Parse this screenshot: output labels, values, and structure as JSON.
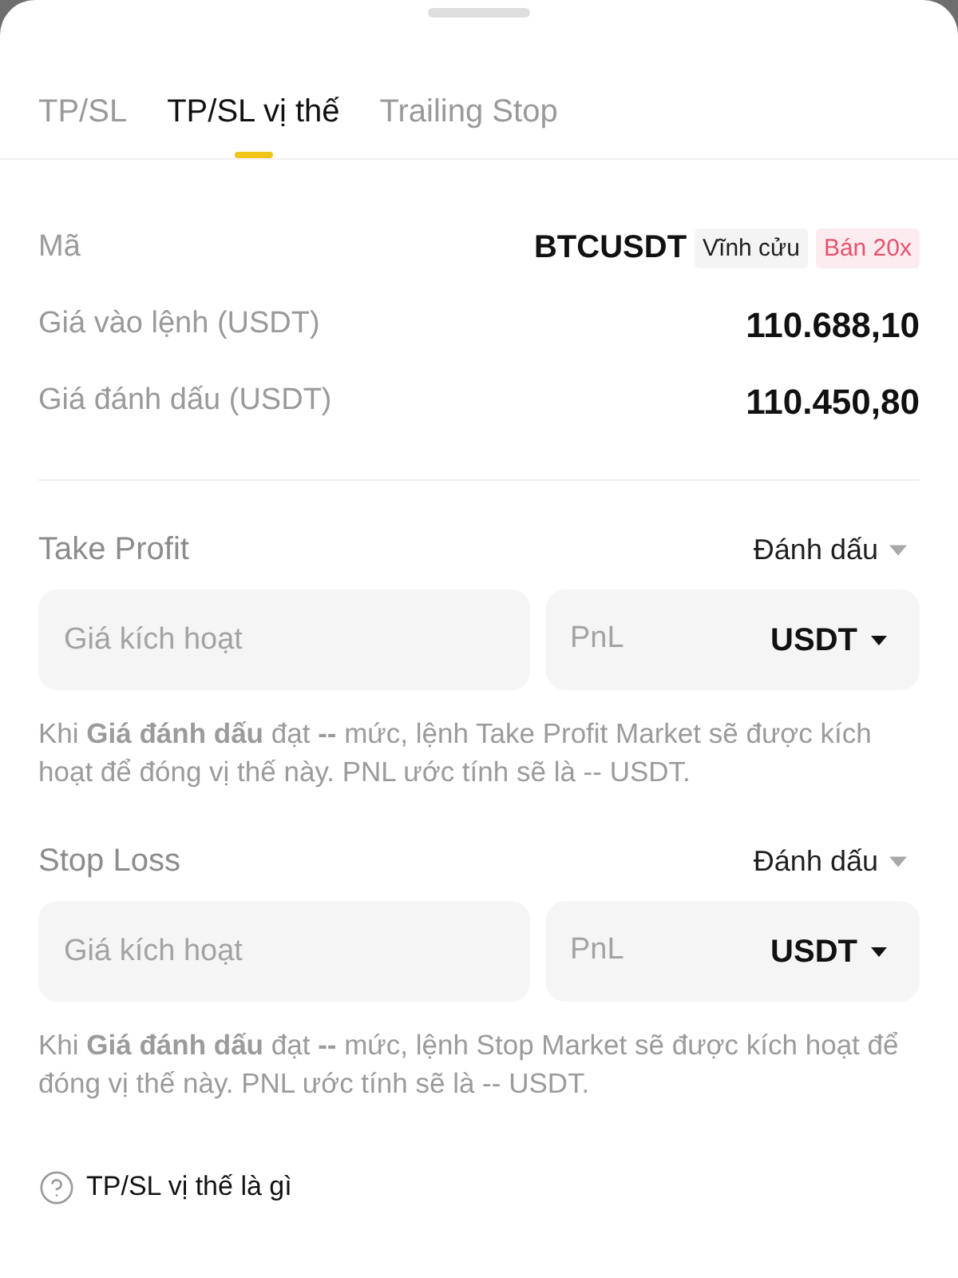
{
  "tabs": [
    {
      "label": "TP/SL",
      "selected": false
    },
    {
      "label": "TP/SL vị thế",
      "selected": true
    },
    {
      "label": "Trailing Stop",
      "selected": false
    }
  ],
  "position": {
    "rows": [
      {
        "kind": "symbol",
        "label": "Mã",
        "value": "BTCUSDT",
        "tags": [
          {
            "kind": "neutral",
            "text": "Vĩnh cửu"
          },
          {
            "kind": "sell",
            "text": "Bán 20x"
          }
        ]
      },
      {
        "kind": "amount",
        "label": "Giá vào lệnh (USDT)",
        "value": "110.688,10"
      },
      {
        "kind": "amount",
        "label": "Giá đánh dấu (USDT)",
        "value": "110.450,80"
      }
    ]
  },
  "sections": [
    {
      "title": "Take Profit",
      "trigger_type": "Đánh dấu",
      "price_field": {
        "placeholder": "Giá kích hoạt"
      },
      "pnl_field": {
        "placeholder": "PnL",
        "unit": "USDT"
      },
      "note": "Khi **Giá đánh dấu** đạt **--** mức, lệnh Take Profit Market sẽ được kích hoạt để đóng vị thế này. PNL ước tính sẽ là -- USDT."
    },
    {
      "title": "Stop Loss",
      "trigger_type": "Đánh dấu",
      "price_field": {
        "placeholder": "Giá kích hoạt"
      },
      "pnl_field": {
        "placeholder": "PnL",
        "unit": "USDT"
      },
      "note": "Khi **Giá đánh dấu** đạt **--** mức, lệnh Stop Market sẽ được kích hoạt để đóng vị thế này. PNL ước tính sẽ là -- USDT."
    }
  ],
  "help_link": "TP/SL vị thế là gì"
}
